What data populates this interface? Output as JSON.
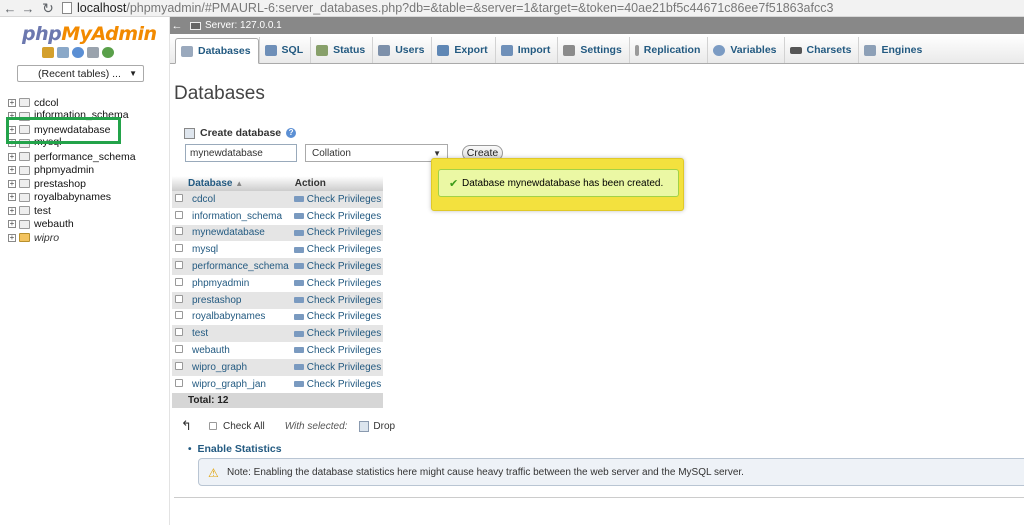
{
  "browser": {
    "url_host": "localhost",
    "url_path": "/phpmyadmin/#PMAURL-6:server_databases.php?db=&table=&server=1&target=&token=40ae21bf5c44671c86ee7f51863afcc3"
  },
  "sidebar": {
    "logo_php": "php",
    "logo_myadmin": "MyAdmin",
    "recent_tables": "(Recent tables) ...",
    "databases": [
      {
        "name": "cdcol"
      },
      {
        "name": "information_schema"
      },
      {
        "name": "mynewdatabase"
      },
      {
        "name": "mysql"
      },
      {
        "name": "performance_schema"
      },
      {
        "name": "phpmyadmin"
      },
      {
        "name": "prestashop"
      },
      {
        "name": "royalbabynames"
      },
      {
        "name": "test"
      },
      {
        "name": "webauth"
      },
      {
        "name": "wipro"
      }
    ]
  },
  "topbar": {
    "server_label": "Server: 127.0.0.1"
  },
  "tabs": [
    {
      "label": "Databases",
      "color": "#9aa9bd"
    },
    {
      "label": "SQL",
      "color": "#6e8fb8"
    },
    {
      "label": "Status",
      "color": "#88a06a"
    },
    {
      "label": "Users",
      "color": "#7d90aa"
    },
    {
      "label": "Export",
      "color": "#5f87b5"
    },
    {
      "label": "Import",
      "color": "#6f90b9"
    },
    {
      "label": "Settings",
      "color": "#8b8b8b"
    },
    {
      "label": "Replication",
      "color": "#9a9a9a"
    },
    {
      "label": "Variables",
      "color": "#7b9bc3"
    },
    {
      "label": "Charsets",
      "color": "#555555"
    },
    {
      "label": "Engines",
      "color": "#8da0b7"
    }
  ],
  "main": {
    "title": "Databases",
    "create_label": "Create database",
    "dbname_value": "mynewdatabase",
    "collation_value": "Collation",
    "create_button": "Create",
    "notice": "Database mynewdatabase has been created.",
    "table": {
      "col_database": "Database",
      "col_action": "Action",
      "rows": [
        {
          "name": "cdcol",
          "action": "Check Privileges"
        },
        {
          "name": "information_schema",
          "action": "Check Privileges"
        },
        {
          "name": "mynewdatabase",
          "action": "Check Privileges"
        },
        {
          "name": "mysql",
          "action": "Check Privileges"
        },
        {
          "name": "performance_schema",
          "action": "Check Privileges"
        },
        {
          "name": "phpmyadmin",
          "action": "Check Privileges"
        },
        {
          "name": "prestashop",
          "action": "Check Privileges"
        },
        {
          "name": "royalbabynames",
          "action": "Check Privileges"
        },
        {
          "name": "test",
          "action": "Check Privileges"
        },
        {
          "name": "webauth",
          "action": "Check Privileges"
        },
        {
          "name": "wipro_graph",
          "action": "Check Privileges"
        },
        {
          "name": "wipro_graph_jan",
          "action": "Check Privileges"
        }
      ],
      "total": "Total: 12"
    },
    "check_all": "Check All",
    "with_selected": "With selected:",
    "drop": "Drop",
    "enable_stats": "Enable Statistics",
    "stats_note": "Note: Enabling the database statistics here might cause heavy traffic between the web server and the MySQL server."
  }
}
